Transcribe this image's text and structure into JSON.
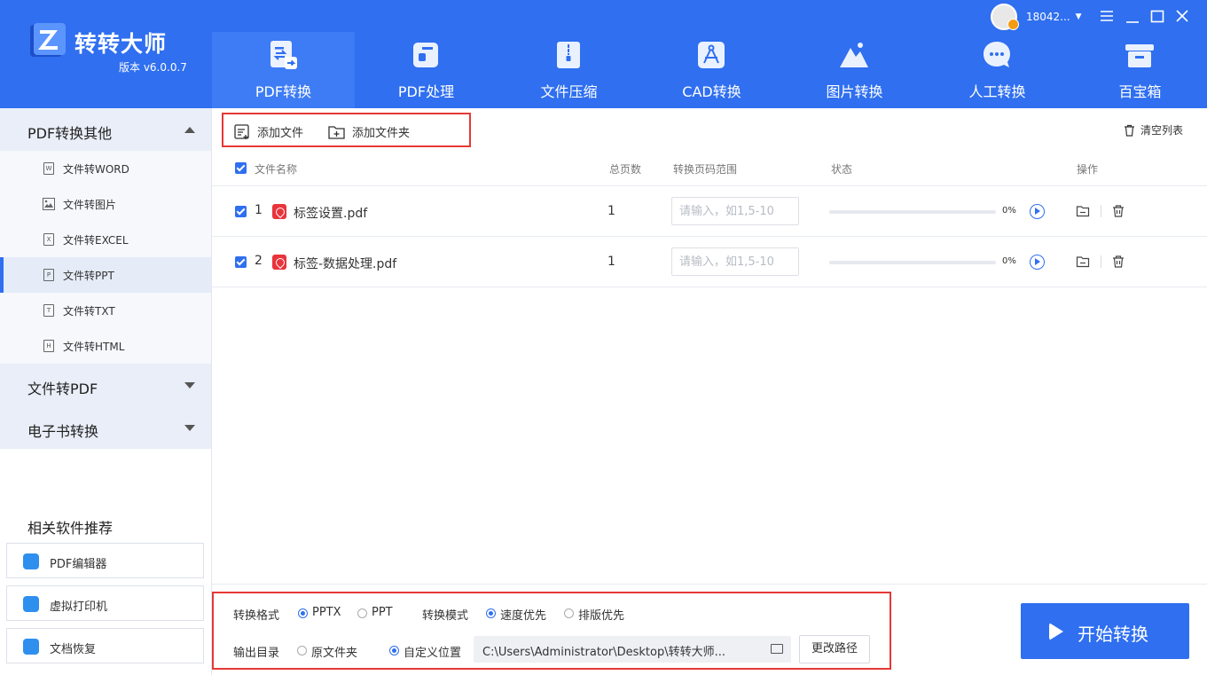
{
  "app": {
    "name": "转转大师",
    "version": "版本 v6.0.0.7"
  },
  "nav": [
    {
      "label": "PDF转换",
      "icon": "pdf-convert-icon",
      "active": true
    },
    {
      "label": "PDF处理",
      "icon": "pdf-process-icon"
    },
    {
      "label": "文件压缩",
      "icon": "file-compress-icon"
    },
    {
      "label": "CAD转换",
      "icon": "cad-convert-icon"
    },
    {
      "label": "图片转换",
      "icon": "image-convert-icon"
    },
    {
      "label": "人工转换",
      "icon": "chat-bubble-icon"
    },
    {
      "label": "百宝箱",
      "icon": "toolbox-icon"
    }
  ],
  "user": {
    "name": "18042..."
  },
  "sidebar": {
    "sections": [
      {
        "label": "PDF转换其他",
        "expanded": true
      },
      {
        "label": "文件转PDF",
        "expanded": false
      },
      {
        "label": "电子书转换",
        "expanded": false
      }
    ],
    "items": [
      {
        "label": "文件转WORD",
        "icon": "word-file-icon",
        "glyph": "W"
      },
      {
        "label": "文件转图片",
        "icon": "image-file-icon",
        "glyph": ""
      },
      {
        "label": "文件转EXCEL",
        "icon": "excel-file-icon",
        "glyph": "X"
      },
      {
        "label": "文件转PPT",
        "icon": "ppt-file-icon",
        "glyph": "P",
        "active": true
      },
      {
        "label": "文件转TXT",
        "icon": "txt-file-icon",
        "glyph": "T"
      },
      {
        "label": "文件转HTML",
        "icon": "html-file-icon",
        "glyph": "H"
      }
    ],
    "recommend_title": "相关软件推荐",
    "recommend": [
      {
        "label": "PDF编辑器",
        "icon": "pdf-editor-icon"
      },
      {
        "label": "虚拟打印机",
        "icon": "virtual-printer-icon"
      },
      {
        "label": "文档恢复",
        "icon": "doc-recovery-icon"
      }
    ]
  },
  "toolbar": {
    "add_file": "添加文件",
    "add_folder": "添加文件夹",
    "clear": "清空列表"
  },
  "table": {
    "headers": {
      "name": "文件名称",
      "pages": "总页数",
      "range": "转换页码范围",
      "status": "状态",
      "ops": "操作"
    },
    "range_placeholder": "请输入，如1,5-10",
    "rows": [
      {
        "index": "1",
        "name": "标签设置.pdf",
        "pages": "1",
        "progress": 0,
        "progress_text": "0%"
      },
      {
        "index": "2",
        "name": "标签-数据处理.pdf",
        "pages": "1",
        "progress": 0,
        "progress_text": "0%"
      }
    ]
  },
  "options": {
    "format_label": "转换格式",
    "formats": [
      {
        "label": "PPTX",
        "selected": true
      },
      {
        "label": "PPT",
        "selected": false
      }
    ],
    "mode_label": "转换模式",
    "modes": [
      {
        "label": "速度优先",
        "selected": true
      },
      {
        "label": "排版优先",
        "selected": false
      }
    ],
    "output_label": "输出目录",
    "outputs": [
      {
        "label": "原文件夹",
        "selected": false
      },
      {
        "label": "自定义位置",
        "selected": true
      }
    ],
    "path": "C:\\Users\\Administrator\\Desktop\\转转大师...",
    "change_path": "更改路径"
  },
  "start_button": "开始转换",
  "colors": {
    "primary": "#2f6ff0",
    "highlight_box": "#e53935",
    "pdf_red": "#e8343b"
  }
}
